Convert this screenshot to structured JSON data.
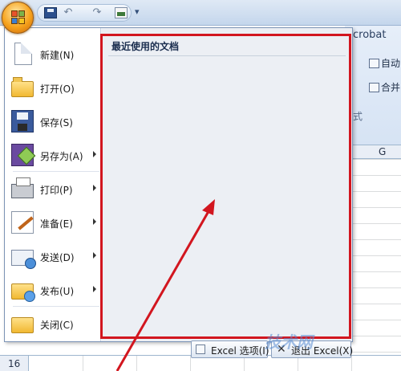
{
  "quick_access": {
    "icons": [
      "save-icon",
      "undo-icon",
      "redo-icon",
      "picture-icon"
    ],
    "undo_glyph": "↶",
    "redo_glyph": "↷",
    "more_glyph": "▾"
  },
  "ribbon": {
    "tab_acrobat": "crobat",
    "item_1": "自动",
    "item_2": "合并",
    "group_label": "式",
    "column_label": "G"
  },
  "menu": {
    "items": [
      {
        "label": "新建(N)",
        "icon": "new-document-icon",
        "has_arrow": false
      },
      {
        "label": "打开(O)",
        "icon": "open-folder-icon",
        "has_arrow": false
      },
      {
        "label": "保存(S)",
        "icon": "floppy-save-icon",
        "has_arrow": false
      },
      {
        "label": "另存为(A)",
        "icon": "save-as-icon",
        "has_arrow": true
      },
      {
        "label": "打印(P)",
        "icon": "printer-icon",
        "has_arrow": true
      },
      {
        "label": "准备(E)",
        "icon": "prepare-icon",
        "has_arrow": true
      },
      {
        "label": "发送(D)",
        "icon": "send-icon",
        "has_arrow": true
      },
      {
        "label": "发布(U)",
        "icon": "publish-icon",
        "has_arrow": true
      },
      {
        "label": "关闭(C)",
        "icon": "close-folder-icon",
        "has_arrow": false
      }
    ],
    "recent_title": "最近使用的文档",
    "options_button": "Excel 选项(I)",
    "exit_button": "退出 Excel(X)"
  },
  "sheet": {
    "row_number": "16"
  },
  "annotation": {
    "color": "#d2161f"
  },
  "watermark": "技术网"
}
